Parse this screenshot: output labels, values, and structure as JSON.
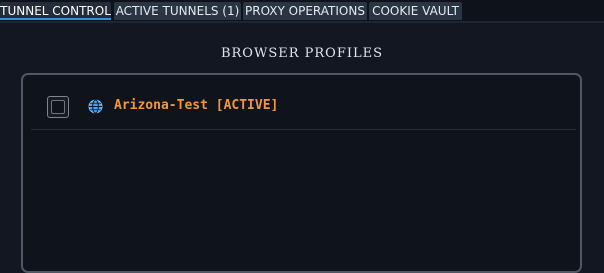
{
  "tabs": [
    {
      "label": "TUNNEL CONTROL",
      "active": true
    },
    {
      "label": "ACTIVE TUNNELS (1)",
      "active": false
    },
    {
      "label": "PROXY OPERATIONS",
      "active": false
    },
    {
      "label": "COOKIE VAULT",
      "active": false
    }
  ],
  "section": {
    "title": "BROWSER PROFILES"
  },
  "profiles": [
    {
      "name": "Arizona-Test [ACTIVE]",
      "checked": false,
      "icon": "globe-icon"
    }
  ],
  "colors": {
    "accent": "#3a8fd8",
    "profile_active": "#f0973a",
    "background": "#121722",
    "panel_border": "#4f5863"
  }
}
